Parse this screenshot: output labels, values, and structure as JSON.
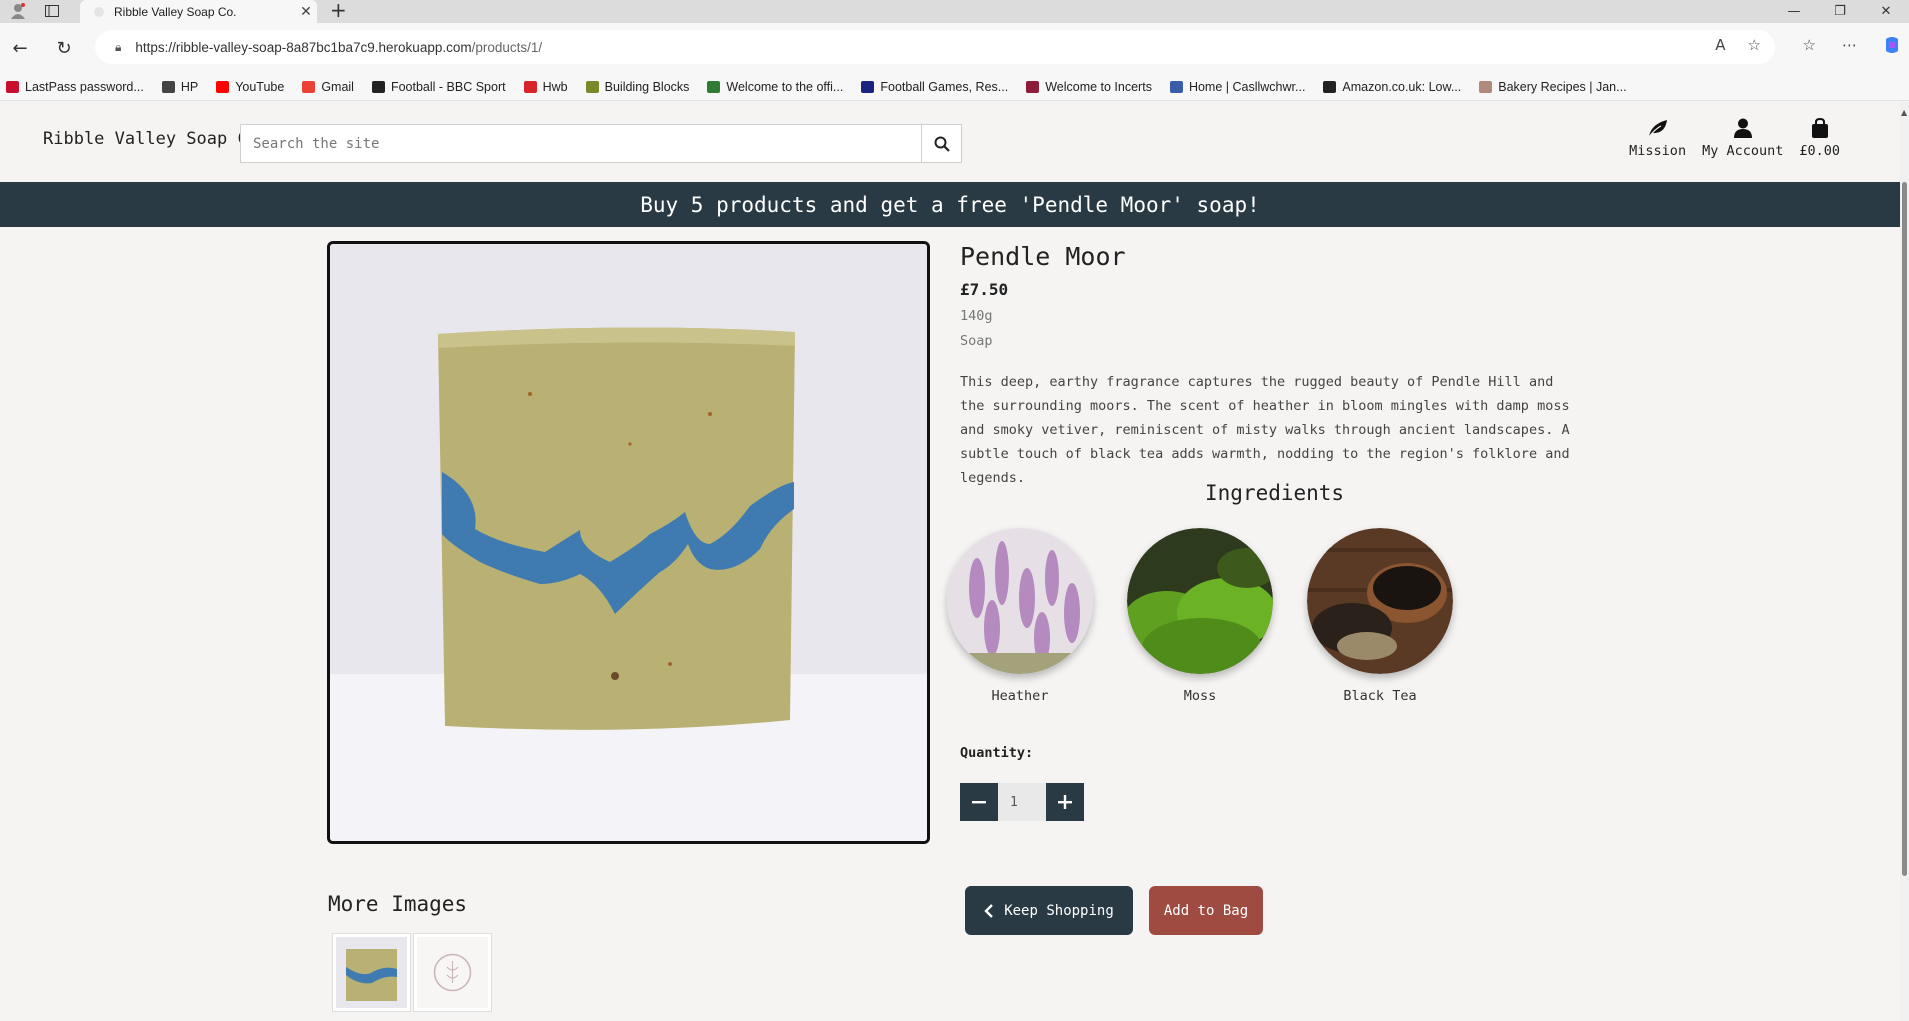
{
  "browser": {
    "tab_title": "Ribble Valley Soap Co.",
    "url_host": "https://ribble-valley-soap-8a87bc1ba7c9.herokuapp.com",
    "url_path": "/products/1/",
    "bookmarks": [
      {
        "label": "LastPass password...",
        "color": "#c8102e"
      },
      {
        "label": "HP",
        "color": "#444444"
      },
      {
        "label": "YouTube",
        "color": "#ff0000"
      },
      {
        "label": "Gmail",
        "color": "#ea4335"
      },
      {
        "label": "Football - BBC Sport",
        "color": "#222222"
      },
      {
        "label": "Hwb",
        "color": "#d6262a"
      },
      {
        "label": "Building Blocks",
        "color": "#7a8a2a"
      },
      {
        "label": "Welcome to the offi...",
        "color": "#2e7d32"
      },
      {
        "label": "Football Games, Res...",
        "color": "#1a237e"
      },
      {
        "label": "Welcome to Incerts",
        "color": "#8e1c3b"
      },
      {
        "label": "Home | Casllwchwr...",
        "color": "#3a5da8"
      },
      {
        "label": "Amazon.co.uk: Low...",
        "color": "#222222"
      },
      {
        "label": "Bakery Recipes | Jan...",
        "color": "#b08a7a"
      }
    ]
  },
  "header": {
    "logo": "Ribble Valley Soap Co.",
    "search_placeholder": "Search the site",
    "links": {
      "mission": "Mission",
      "account": "My Account",
      "bag": "£0.00"
    }
  },
  "promo": "Buy 5 products and get a free 'Pendle Moor' soap!",
  "product": {
    "name": "Pendle Moor",
    "price": "£7.50",
    "weight": "140g",
    "category": "Soap",
    "description": "This deep, earthy fragrance captures the rugged beauty of Pendle Hill and the surrounding moors. The scent of heather in bloom mingles with damp moss and smoky vetiver, reminiscent of misty walks through ancient landscapes. A subtle touch of black tea adds warmth, nodding to the region's folklore and legends.",
    "ingredients_title": "Ingredients",
    "ingredients": [
      "Heather",
      "Moss",
      "Black Tea"
    ],
    "quantity_label": "Quantity:",
    "quantity": "1",
    "keep_shopping": "Keep Shopping",
    "add_to_bag": "Add to Bag",
    "more_images": "More Images"
  },
  "colors": {
    "dark": "#293a44",
    "accent": "#a04b41",
    "page_bg": "#f5f4f3"
  }
}
